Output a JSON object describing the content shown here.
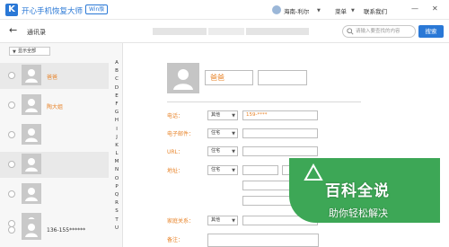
{
  "app": {
    "logo_letter": "K",
    "title": "开心手机恢复大师",
    "badge": "Win版",
    "user_name": "海南-利尔",
    "menu_label": "菜单",
    "contact_label": "联系我们",
    "minimize": "—",
    "close": "✕"
  },
  "toolbar": {
    "back_icon": "back-arrow-icon",
    "title": "通讯录",
    "search_placeholder": "请输入要查找的内容",
    "search_button": "搜索"
  },
  "sidebar": {
    "filter_label": "显示全部",
    "contacts": [
      {
        "name": "爸爸",
        "name_color": "#e8842a",
        "selected": true
      },
      {
        "name": "陶大姐",
        "name_color": "#e8842a",
        "selected": false
      },
      {
        "name": "",
        "selected": false
      },
      {
        "name": "",
        "selected": true
      },
      {
        "name": "",
        "selected": false
      },
      {
        "name": "",
        "selected": false
      },
      {
        "name": "136-155******",
        "name_color": "#333333",
        "selected": false
      }
    ],
    "alphabet": [
      "A",
      "B",
      "C",
      "D",
      "E",
      "F",
      "G",
      "H",
      "I",
      "J",
      "K",
      "L",
      "M",
      "N",
      "O",
      "P",
      "Q",
      "R",
      "S",
      "T",
      "U"
    ]
  },
  "detail": {
    "name_value": "爸爸",
    "name_color": "#e8842a",
    "label_color": "#e8842a",
    "fields": {
      "phone_label": "电话：",
      "phone_type": "其他",
      "phone_value": "159-****",
      "email_label": "电子邮件：",
      "email_type": "住宅",
      "url_label": "URL：",
      "url_type": "住宅",
      "address_label": "地址：",
      "address_type": "住宅",
      "family_label": "家庭关系：",
      "family_type": "其他",
      "note_label": "备注："
    }
  },
  "watermark": {
    "title": "百科全说",
    "subtitle": "助你轻松解决",
    "color": "#3da756"
  }
}
